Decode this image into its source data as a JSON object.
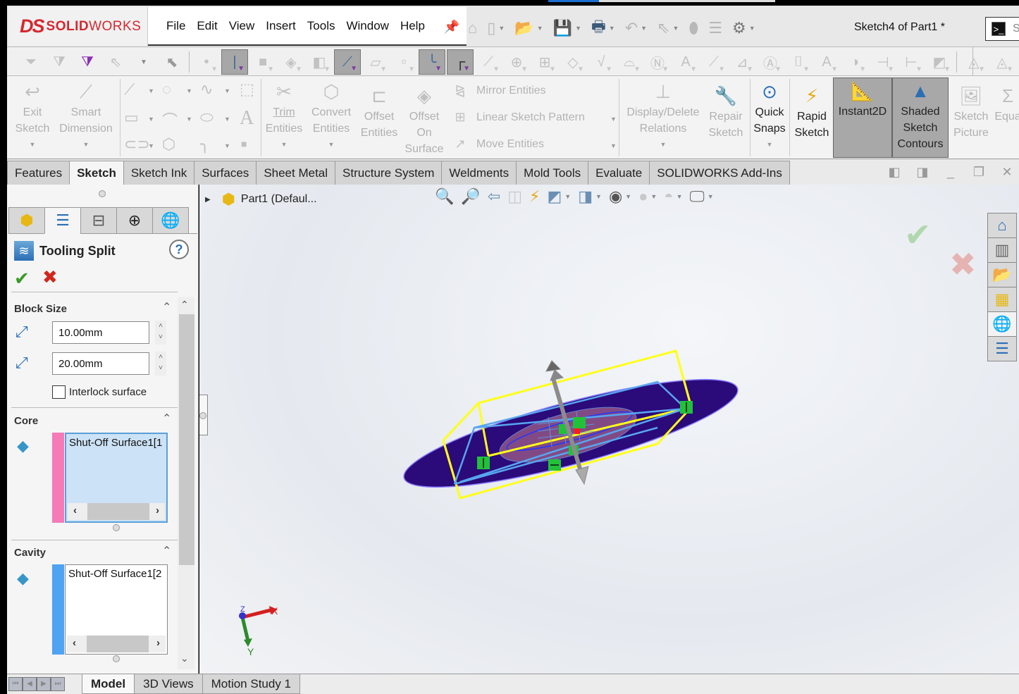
{
  "app": {
    "brand": "SOLIDWORKS",
    "brand_prefix": "DS",
    "document_title": "Sketch4 of Part1 *",
    "search_hint": "S"
  },
  "menu": [
    "File",
    "Edit",
    "View",
    "Insert",
    "Tools",
    "Window",
    "Help"
  ],
  "quick_access": [
    "home-icon",
    "new-document-icon",
    "open-icon",
    "save-icon",
    "print-icon",
    "undo-icon",
    "select-icon",
    "rebuild-icon",
    "file-properties-icon",
    "options-icon"
  ],
  "selection_filters": {
    "active": [
      "filter-edges",
      "filter-axes",
      "filter-sketch-segments",
      "filter-sketch-points"
    ]
  },
  "ribbon": {
    "exit_sketch": {
      "line1": "Exit",
      "line2": "Sketch"
    },
    "smart_dimension": {
      "line1": "Smart",
      "line2": "Dimension"
    },
    "trim_entities": {
      "line1": "Trim",
      "line2": "Entities"
    },
    "convert_entities": {
      "line1": "Convert",
      "line2": "Entities"
    },
    "offset_entities": {
      "line1": "Offset",
      "line2": "Entities"
    },
    "offset_on_surface": {
      "line1": "Offset",
      "line2": "On",
      "line3": "Surface"
    },
    "mirror_entities": "Mirror Entities",
    "linear_sketch_pattern": "Linear Sketch Pattern",
    "move_entities": "Move Entities",
    "display_delete_relations": {
      "line1": "Display/Delete",
      "line2": "Relations"
    },
    "repair_sketch": {
      "line1": "Repair",
      "line2": "Sketch"
    },
    "quick_snaps": {
      "line1": "Quick",
      "line2": "Snaps"
    },
    "rapid_sketch": {
      "line1": "Rapid",
      "line2": "Sketch"
    },
    "instant2d": "Instant2D",
    "shaded_sketch_contours": {
      "line1": "Shaded",
      "line2": "Sketch",
      "line3": "Contours"
    },
    "sketch_picture": {
      "line1": "Sketch",
      "line2": "Picture"
    },
    "equations": "Equa"
  },
  "tabs": [
    {
      "label": "Features",
      "active": false
    },
    {
      "label": "Sketch",
      "active": true
    },
    {
      "label": "Sketch Ink",
      "active": false
    },
    {
      "label": "Surfaces",
      "active": false
    },
    {
      "label": "Sheet Metal",
      "active": false
    },
    {
      "label": "Structure System",
      "active": false
    },
    {
      "label": "Weldments",
      "active": false
    },
    {
      "label": "Mold Tools",
      "active": false
    },
    {
      "label": "Evaluate",
      "active": false
    },
    {
      "label": "SOLIDWORKS Add-Ins",
      "active": false
    }
  ],
  "property_manager": {
    "title": "Tooling Split",
    "block_size": {
      "header": "Block Size",
      "depth1": "10.00mm",
      "depth2": "20.00mm",
      "interlock_label": "Interlock surface",
      "interlock_checked": false
    },
    "core": {
      "header": "Core",
      "item": "Shut-Off Surface1[1",
      "strip_color": "#f47ab8"
    },
    "cavity": {
      "header": "Cavity",
      "item": "Shut-Off Surface1[2",
      "strip_color": "#4ea3f2"
    }
  },
  "feature_tree": {
    "root": "Part1  (Defaul..."
  },
  "triad": {
    "x": "X",
    "y": "Y",
    "z": "Z"
  },
  "bottom_tabs": [
    {
      "label": "Model",
      "active": true
    },
    {
      "label": "3D Views",
      "active": false
    },
    {
      "label": "Motion Study 1",
      "active": false
    }
  ],
  "colors": {
    "brand": "#d5282e",
    "ok": "#3a9a26",
    "cancel": "#d0271d",
    "block_outline": "#ffff1a",
    "surface_fill": "#2b0a7a",
    "sketch_lines": "#58a6f0"
  }
}
